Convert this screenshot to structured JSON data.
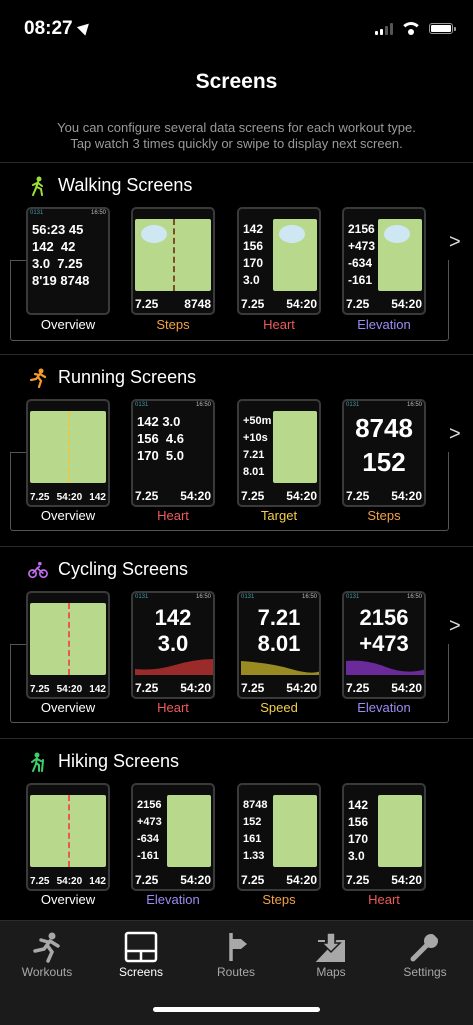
{
  "status": {
    "time": "08:27"
  },
  "header": {
    "title": "Screens",
    "description_line1": "You can configure several data screens for each workout type.",
    "description_line2": "Tap watch 3 times quickly or swipe to display next screen."
  },
  "sections": {
    "walking": {
      "title": "Walking Screens",
      "labels": [
        "Overview",
        "Steps",
        "Heart",
        "Elevation"
      ]
    },
    "running": {
      "title": "Running Screens",
      "labels": [
        "Overview",
        "Heart",
        "Target",
        "Steps"
      ]
    },
    "cycling": {
      "title": "Cycling Screens",
      "labels": [
        "Overview",
        "Heart",
        "Speed",
        "Elevation"
      ]
    },
    "hiking": {
      "title": "Hiking Screens",
      "labels": [
        "Overview",
        "Elevation",
        "Steps",
        "Heart"
      ]
    }
  },
  "watch_values": {
    "distance": "7.25",
    "time": "54:20",
    "steps": "8748",
    "heart": "142",
    "pace": "3.0",
    "speed1": "7.21",
    "speed2": "8.01",
    "elev1": "2156",
    "elev2": "+473",
    "cadence": "152",
    "clock": "16:50"
  },
  "tabs": [
    {
      "label": "Workouts",
      "icon": "runner-icon"
    },
    {
      "label": "Screens",
      "icon": "screens-icon"
    },
    {
      "label": "Routes",
      "icon": "route-sign-icon"
    },
    {
      "label": "Maps",
      "icon": "download-map-icon"
    },
    {
      "label": "Settings",
      "icon": "wrench-icon"
    }
  ],
  "colors": {
    "steps": "#f3a24a",
    "heart": "#ee5a5a",
    "elevation": "#9b8cf3",
    "speed": "#f2d04a"
  }
}
